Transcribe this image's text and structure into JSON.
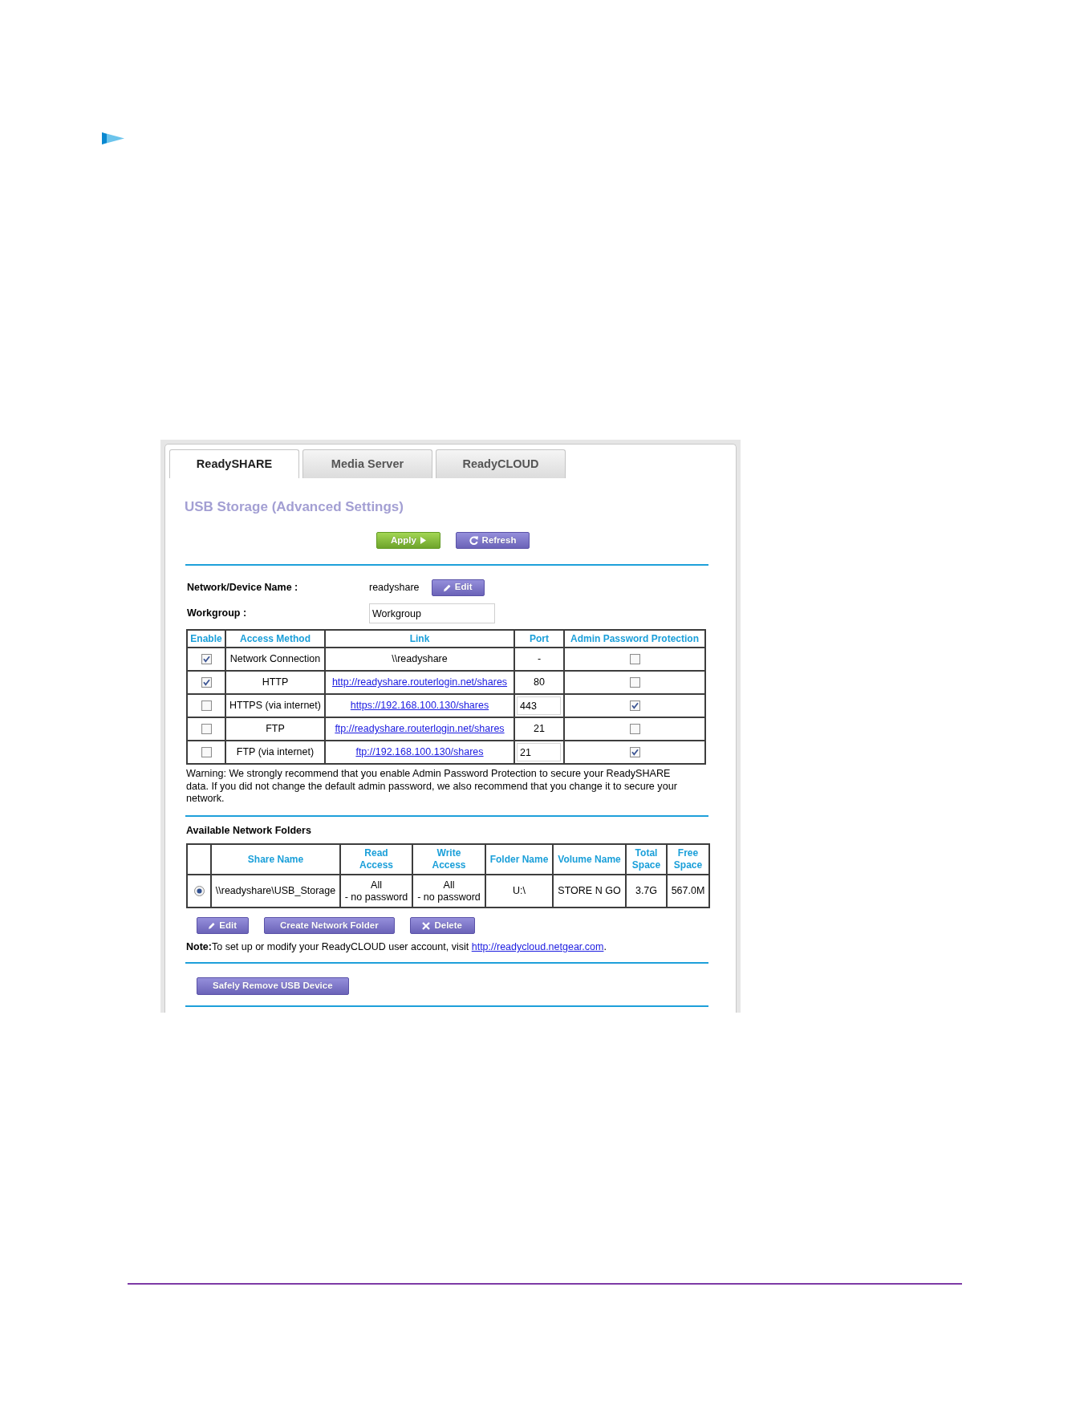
{
  "tabs": [
    {
      "label": "ReadySHARE",
      "selected": true
    },
    {
      "label": "Media Server",
      "selected": false
    },
    {
      "label": "ReadyCLOUD",
      "selected": false
    }
  ],
  "title": "USB Storage (Advanced Settings)",
  "actions": [
    {
      "label": "Apply",
      "kind": "apply"
    },
    {
      "label": "Refresh",
      "kind": "refresh"
    }
  ],
  "device_name": {
    "label": "Network/Device Name :",
    "value": "readyshare",
    "button": {
      "label": "Edit",
      "kind": "edit"
    }
  },
  "workgroup": {
    "label": "Workgroup :",
    "value": "Workgroup"
  },
  "access_table": {
    "columns": [
      "Enable",
      "Access Method",
      "Link",
      "Port",
      "Admin Password Protection"
    ],
    "rows": [
      {
        "enabled": true,
        "method": "Network Connection",
        "link": {
          "text": "\\\\readyshare",
          "kind": "text"
        },
        "port": {
          "text": "-",
          "kind": "text"
        },
        "password_protection": false
      },
      {
        "enabled": true,
        "method": "HTTP",
        "link": {
          "text": "http://readyshare.routerlogin.net/shares",
          "kind": "hyperlink"
        },
        "port": {
          "text": "80",
          "kind": "text"
        },
        "password_protection": false
      },
      {
        "enabled": false,
        "method": "HTTPS (via internet)",
        "link": {
          "text": "https://192.168.100.130/shares",
          "kind": "hyperlink"
        },
        "port": {
          "text": "443",
          "kind": "field"
        },
        "password_protection": true
      },
      {
        "enabled": false,
        "method": "FTP",
        "link": {
          "text": "ftp://readyshare.routerlogin.net/shares",
          "kind": "hyperlink"
        },
        "port": {
          "text": "21",
          "kind": "text"
        },
        "password_protection": false
      },
      {
        "enabled": false,
        "method": "FTP (via internet)",
        "link": {
          "text": "ftp://192.168.100.130/shares",
          "kind": "hyperlink"
        },
        "port": {
          "text": "21",
          "kind": "field"
        },
        "password_protection": true
      }
    ]
  },
  "warning": "Warning: We strongly recommend that you enable Admin Password Protection to secure your ReadySHARE data. If you did not change the default admin password, we also recommend that you change it to secure your network.",
  "folders": {
    "heading": "Available Network Folders",
    "columns": [
      "Share Name",
      "Read\nAccess",
      "Write\nAccess",
      "Folder Name",
      "Volume Name",
      "Total\nSpace",
      "Free\nSpace"
    ],
    "rows": [
      {
        "selected": true,
        "cells": [
          "\\\\readyshare\\USB_Storage",
          "All\n- no password",
          "All\n- no password",
          "U:\\",
          "STORE N GO",
          "3.7G",
          "567.0M"
        ]
      }
    ],
    "buttons": [
      {
        "label": "Edit",
        "kind": "edit"
      },
      {
        "label": "Create Network Folder",
        "kind": "create"
      },
      {
        "label": "Delete",
        "kind": "delete"
      }
    ]
  },
  "note": {
    "text": "**Note:**To set up or modify your ReadyCLOUD user account, visit",
    "link": "http://readycloud.netgear.com",
    "after": "."
  },
  "remove_button": {
    "label": "Safely Remove USB Device",
    "kind": "remove"
  }
}
